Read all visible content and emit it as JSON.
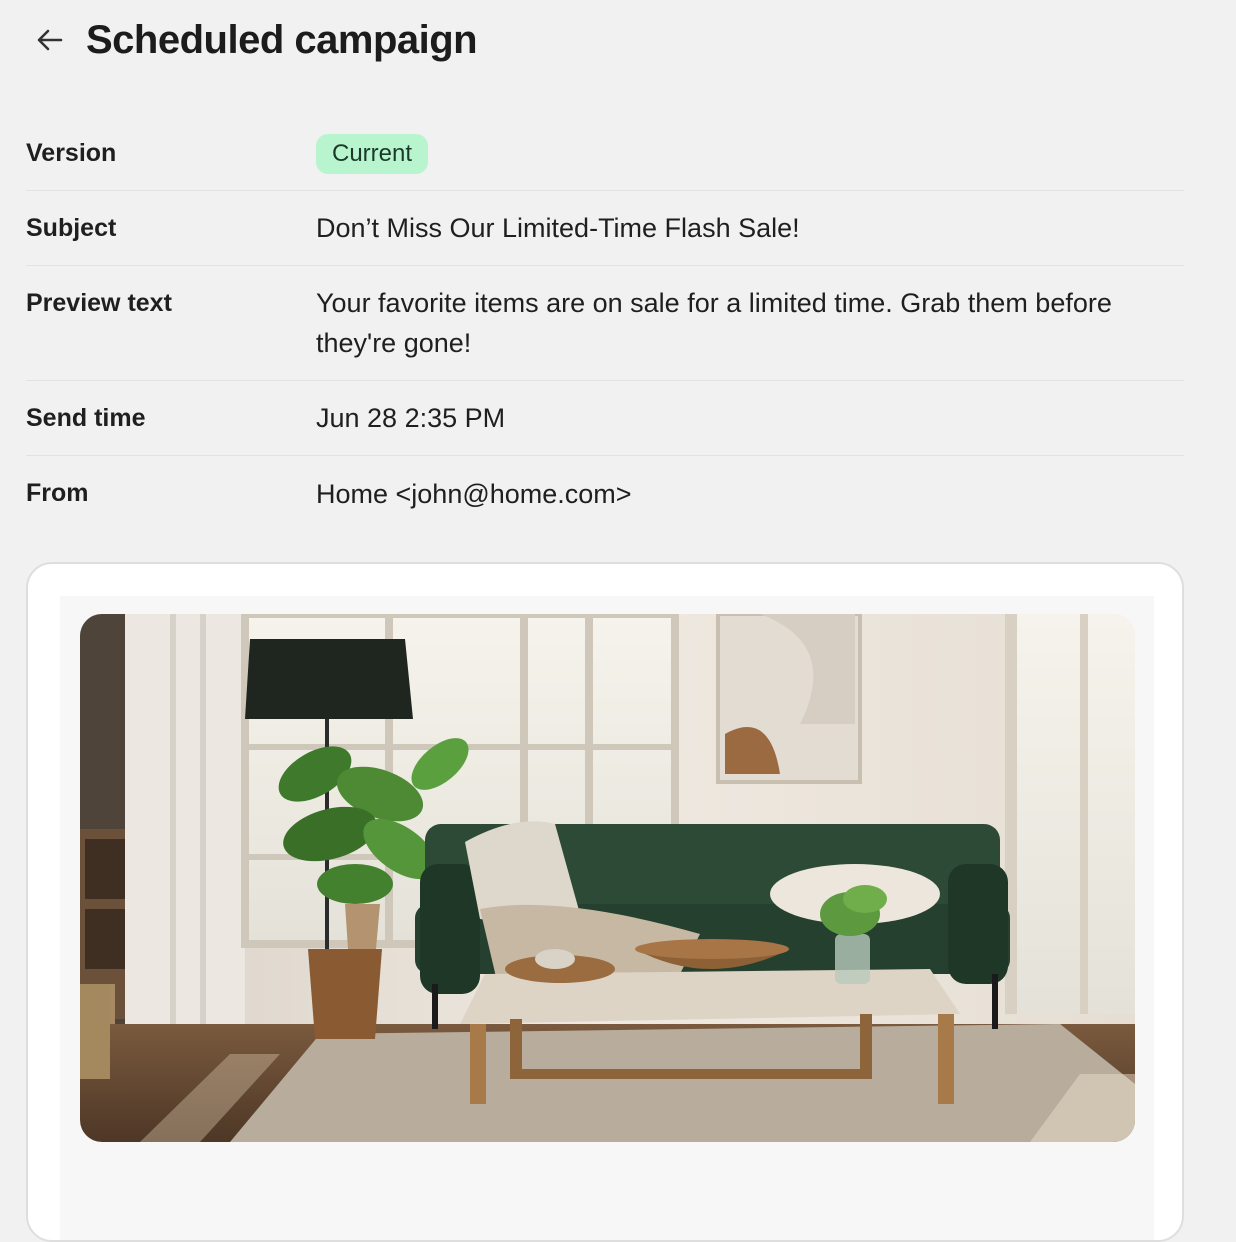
{
  "header": {
    "back_icon": "arrow-left-icon",
    "title": "Scheduled campaign"
  },
  "details": {
    "version": {
      "label": "Version",
      "value": "Current",
      "badge_color": "#b8f5cf"
    },
    "subject": {
      "label": "Subject",
      "value": "Don’t Miss Our Limited-Time Flash Sale!"
    },
    "preview_text": {
      "label": "Preview text",
      "value": "Your favorite items are on sale for a limited time. Grab them before they're gone!"
    },
    "send_time": {
      "label": "Send time",
      "value": "Jun 28 2:35 PM"
    },
    "from": {
      "label": "From",
      "value": "Home <john@home.com>"
    }
  },
  "email_preview": {
    "hero_image": "living-room-photo"
  }
}
